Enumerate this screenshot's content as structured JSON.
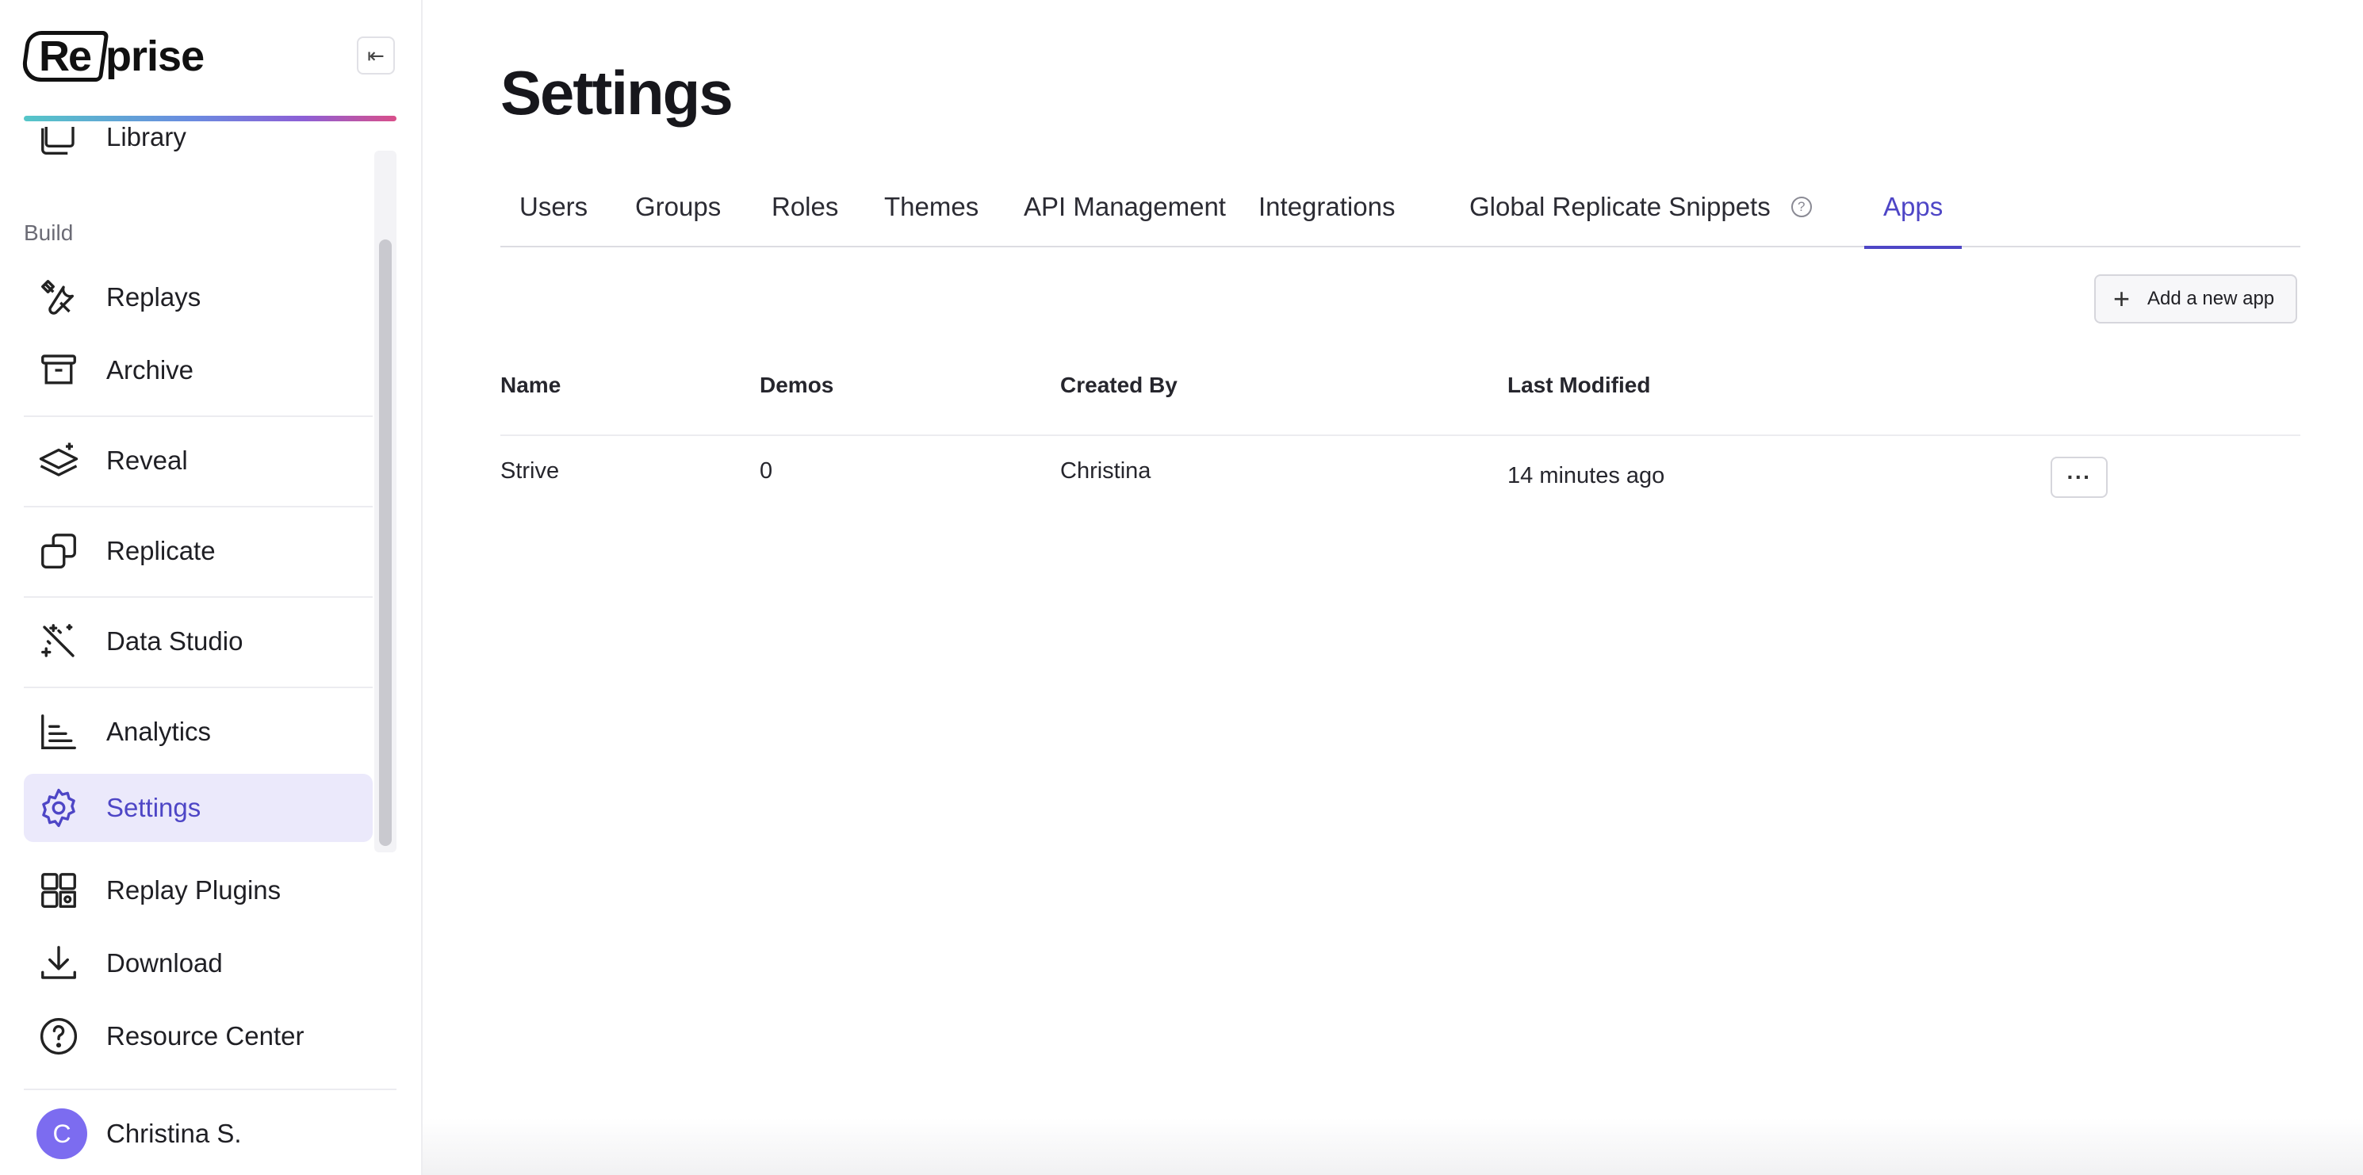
{
  "sidebar": {
    "logo": {
      "left": "Re",
      "right": "prise"
    },
    "collapse_glyph": "⇤",
    "section_build": "Build",
    "items": [
      {
        "label": "Library",
        "icon": "library-icon"
      },
      {
        "label": "Replays",
        "icon": "tools-icon"
      },
      {
        "label": "Archive",
        "icon": "archive-icon"
      },
      {
        "label": "Reveal",
        "icon": "layers-sparkle-icon"
      },
      {
        "label": "Replicate",
        "icon": "copy-icon"
      },
      {
        "label": "Data Studio",
        "icon": "magic-wand-icon"
      },
      {
        "label": "Analytics",
        "icon": "chart-icon"
      },
      {
        "label": "Settings",
        "icon": "gear-icon",
        "active": true
      }
    ],
    "bottom_items": [
      {
        "label": "Replay Plugins",
        "icon": "puzzle-icon"
      },
      {
        "label": "Download",
        "icon": "download-icon"
      },
      {
        "label": "Resource Center",
        "icon": "help-circle-icon"
      }
    ],
    "user": {
      "initial": "C",
      "name": "Christina S."
    }
  },
  "main": {
    "title": "Settings",
    "tabs": [
      {
        "label": "Users"
      },
      {
        "label": "Groups"
      },
      {
        "label": "Roles"
      },
      {
        "label": "Themes"
      },
      {
        "label": "API Management"
      },
      {
        "label": "Integrations"
      },
      {
        "label": "Global Replicate Snippets",
        "help": "?"
      },
      {
        "label": "Apps",
        "active": true
      }
    ],
    "add_button": {
      "label": "Add a new app",
      "glyph": "+"
    },
    "table": {
      "columns": [
        "Name",
        "Demos",
        "Created By",
        "Last Modified"
      ],
      "rows": [
        {
          "name": "Strive",
          "demos": "0",
          "created_by": "Christina",
          "last_modified": "14 minutes ago",
          "more": "···"
        }
      ]
    }
  },
  "colors": {
    "accent": "#4e46c6",
    "active_bg": "#ebe9fb",
    "avatar": "#7c6cf0"
  }
}
